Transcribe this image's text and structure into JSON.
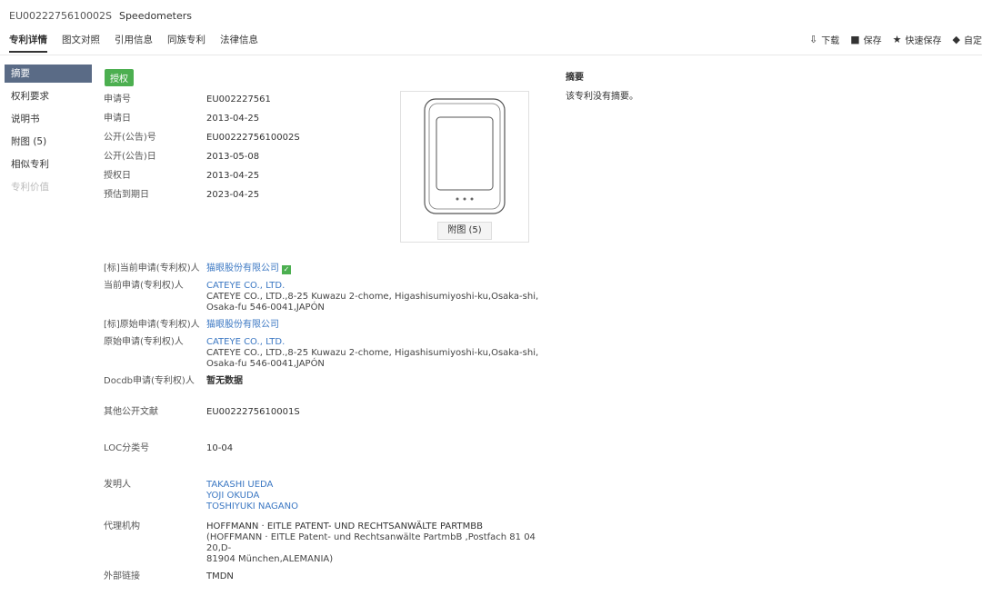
{
  "header": {
    "patent_number": "EU0022275610002S",
    "patent_title": "Speedometers",
    "tabs": [
      "专利详情",
      "图文对照",
      "引用信息",
      "同族专利",
      "法律信息"
    ],
    "actions": [
      {
        "icon": "download-icon",
        "label": "下载"
      },
      {
        "icon": "save-icon",
        "label": "保存"
      },
      {
        "icon": "star-icon",
        "label": "快速保存"
      },
      {
        "icon": "tag-icon",
        "label": "自定"
      }
    ]
  },
  "sidebar": {
    "items": [
      "摘要",
      "权利要求",
      "说明书",
      "附图 (5)",
      "相似专利",
      "专利价值"
    ]
  },
  "status_badge": "授权",
  "fields": [
    {
      "label": "申请号",
      "value": "EU002227561"
    },
    {
      "label": "申请日",
      "value": "2013-04-25"
    },
    {
      "label": "公开(公告)号",
      "value": "EU0022275610002S"
    },
    {
      "label": "公开(公告)日",
      "value": "2013-05-08"
    },
    {
      "label": "授权日",
      "value": "2013-04-25"
    },
    {
      "label": "预估到期日",
      "value": "2023-04-25"
    }
  ],
  "figure": {
    "button_label": "附图 (5)"
  },
  "abstract": {
    "heading": "摘要",
    "text": "该专利没有摘要。"
  },
  "people": {
    "std_current_applicant_label": "[标]当前申请(专利权)人",
    "std_current_applicant": "猫眼股份有限公司",
    "current_applicant_label": "当前申请(专利权)人",
    "current_applicant_name": "CATEYE CO., LTD.",
    "current_applicant_addr_1": "CATEYE CO., LTD.,8-25 Kuwazu 2-chome, Higashisumiyoshi-ku,Osaka-shi,",
    "current_applicant_addr_2": "Osaka-fu 546-0041,JAPÓN",
    "std_original_applicant_label": "[标]原始申请(专利权)人",
    "std_original_applicant": "猫眼股份有限公司",
    "original_applicant_label": "原始申请(专利权)人",
    "original_applicant_name": "CATEYE CO., LTD.",
    "original_applicant_addr_1": "CATEYE CO., LTD.,8-25 Kuwazu 2-chome, Higashisumiyoshi-ku,Osaka-shi,",
    "original_applicant_addr_2": "Osaka-fu 546-0041,JAPÓN",
    "docdb_label": "Docdb申请(专利权)人",
    "docdb_value": "暂无数据",
    "other_pub_label": "其他公开文献",
    "other_pub_value": "EU0022275610001S",
    "loc_label": "LOC分类号",
    "loc_value": "10-04",
    "inventor_label": "发明人",
    "inventors": [
      "TAKASHI UEDA",
      "YOJI OKUDA",
      "TOSHIYUKI NAGANO"
    ],
    "agency_label": "代理机构",
    "agency_name": "HOFFMANN · EITLE PATENT- UND RECHTSANWÄLTE PARTMBB",
    "agency_addr_1": "(HOFFMANN · EITLE Patent- und Rechtsanwälte PartmbB ,Postfach 81 04 20,D-",
    "agency_addr_2": "81904 München,ALEMANIA)",
    "external_label": "外部链接",
    "external_value": "TMDN"
  }
}
